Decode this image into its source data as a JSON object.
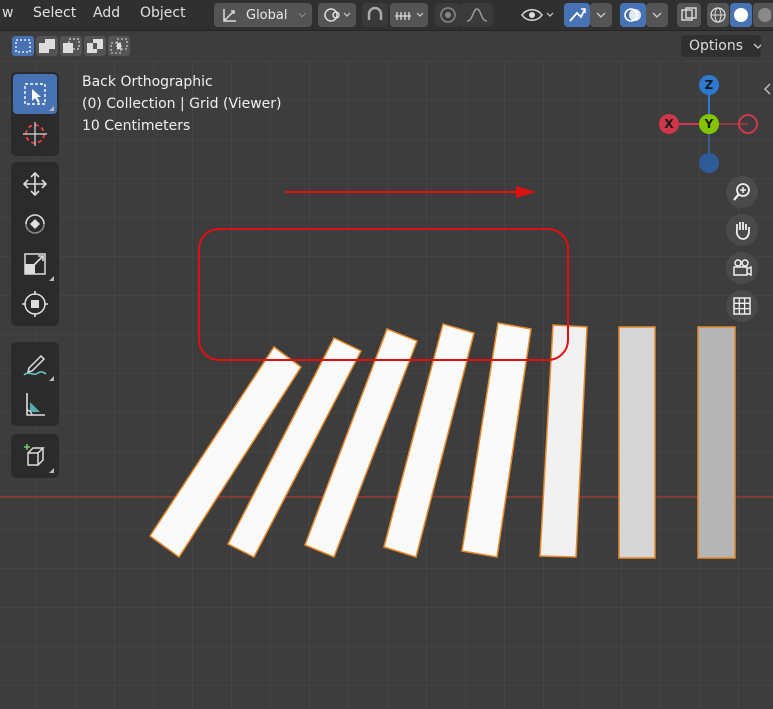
{
  "header": {
    "menu_view": "w",
    "menu_select": "Select",
    "menu_add": "Add",
    "menu_object": "Object",
    "orientation": "Global",
    "icons": [
      "transform-orientation-icon",
      "pivot-icon",
      "snap-icon",
      "snap-increment-icon",
      "proportional-edit-icon",
      "falloff-icon",
      "visibility-icon",
      "gizmo-icon",
      "overlay-icon",
      "xray-icon",
      "wireframe-shading-icon",
      "solid-shading-icon",
      "material-shading-icon"
    ]
  },
  "subbar": {
    "options_label": "Options"
  },
  "viewport": {
    "view_name": "Back Orthographic",
    "collection": "(0) Collection | Grid (Viewer)",
    "scale": "10 Centimeters"
  },
  "gizmo": {
    "z": "Z",
    "x": "X",
    "y": "Y",
    "colors": {
      "x": "#d0364a",
      "y": "#82c400",
      "z": "#2e78d0"
    }
  },
  "annotations": {
    "arrow_color": "#e01010",
    "box_color": "#e01010"
  },
  "colors": {
    "accent": "#4772b3",
    "selection_outline": "#e88a2a"
  }
}
